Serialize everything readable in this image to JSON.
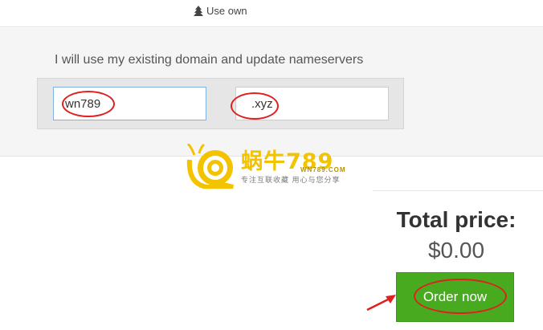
{
  "tabs": {
    "use_own": {
      "label": "Use own",
      "icon": "tree-icon"
    }
  },
  "domain_section": {
    "label": "I will use my existing domain and update nameservers",
    "sld_value": "wn789",
    "tld_value": ".xyz"
  },
  "watermark": {
    "brand": "蜗牛789",
    "domain": "WN789.COM",
    "slogan": "专注互联收藏  用心与您分享"
  },
  "summary": {
    "total_label": "Total price:",
    "total_value": "$0.00",
    "order_button": "Order now"
  },
  "colors": {
    "order_button": "#48ab1f",
    "annotation": "#e02020",
    "input_focus_border": "#7fb3e4",
    "panel_background": "#f5f5f5",
    "logo_yellow": "#f3c300"
  }
}
